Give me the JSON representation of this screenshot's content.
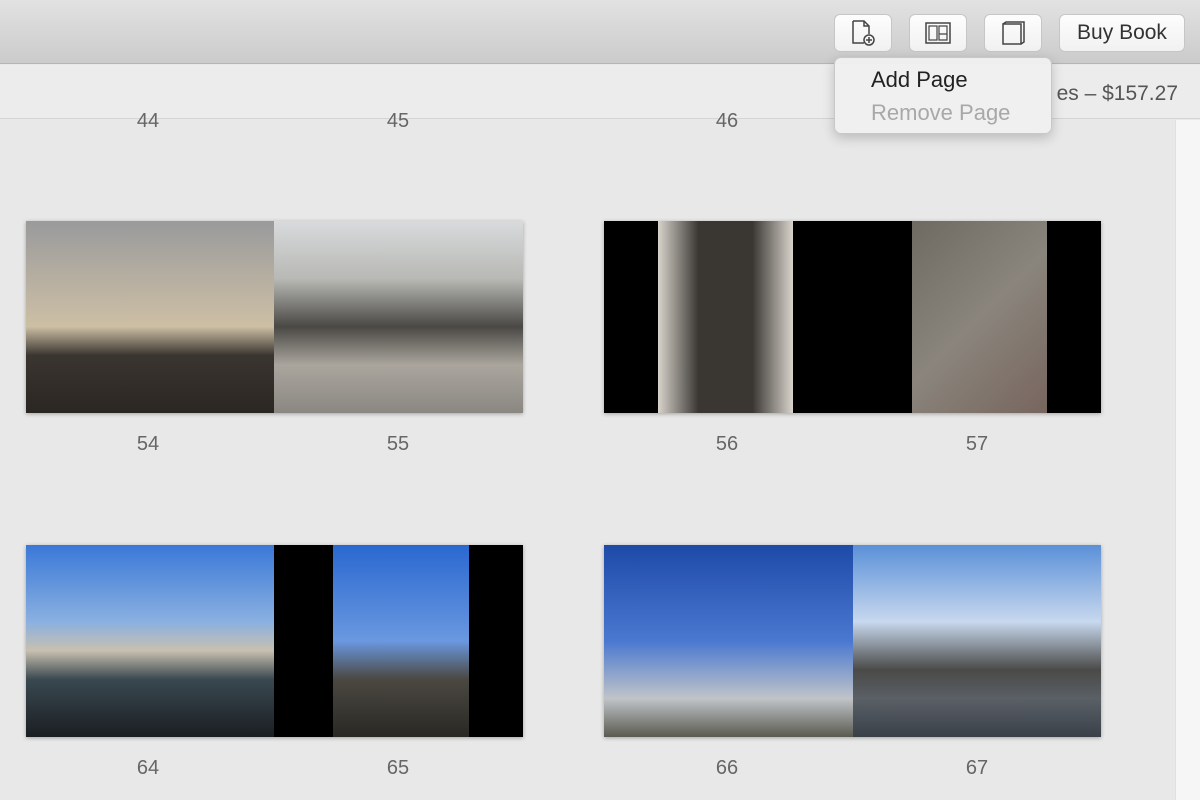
{
  "toolbar": {
    "add_page_icon": "document-plus-icon",
    "layout_icon": "layout-icon",
    "book_icon": "book-icon",
    "buy_book_label": "Buy Book"
  },
  "subbar": {
    "price_text": "es – $157.27"
  },
  "menu": {
    "add_page": "Add Page",
    "remove_page": "Remove Page"
  },
  "pages": {
    "top": [
      "44",
      "45",
      "46"
    ],
    "row1": [
      "54",
      "55",
      "56",
      "57"
    ],
    "row2": [
      "64",
      "65",
      "66",
      "67"
    ]
  },
  "colors": {
    "accent_disabled": "#a8a8a8"
  }
}
